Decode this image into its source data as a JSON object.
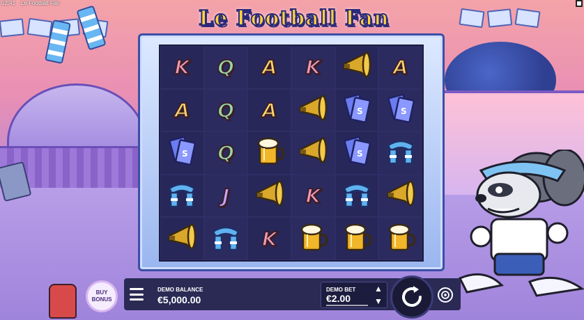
{
  "status_bar": {
    "time": "02:41",
    "app_title": "Le Football Fan"
  },
  "logo": {
    "title": "Le Football Fan"
  },
  "reels": {
    "columns": 6,
    "rows": 5,
    "symbols": [
      [
        "K",
        "Q",
        "A",
        "K",
        "horn",
        "A"
      ],
      [
        "A",
        "Q",
        "A",
        "horn",
        "tickets",
        "tickets"
      ],
      [
        "tickets",
        "Q",
        "beer",
        "horn",
        "tickets",
        "scarf"
      ],
      [
        "scarf",
        "J",
        "horn",
        "K",
        "scarf",
        "horn"
      ],
      [
        "horn",
        "scarf",
        "K",
        "beer",
        "beer",
        "beer"
      ]
    ]
  },
  "controls": {
    "buy_bonus_label": "BUY\nBONUS",
    "balance_label": "DEMO BALANCE",
    "balance_value": "€5,000.00",
    "bet_label": "DEMO BET",
    "bet_value": "€2.00"
  },
  "colors": {
    "logo_yellow": "#ffd23a",
    "reel_bg": "#242452",
    "panel_bg": "#2a2a55",
    "letter_K": "#f29ab6",
    "letter_Q": "#9ad6a4",
    "letter_A": "#ffd66a",
    "letter_J": "#c7a4ff"
  }
}
